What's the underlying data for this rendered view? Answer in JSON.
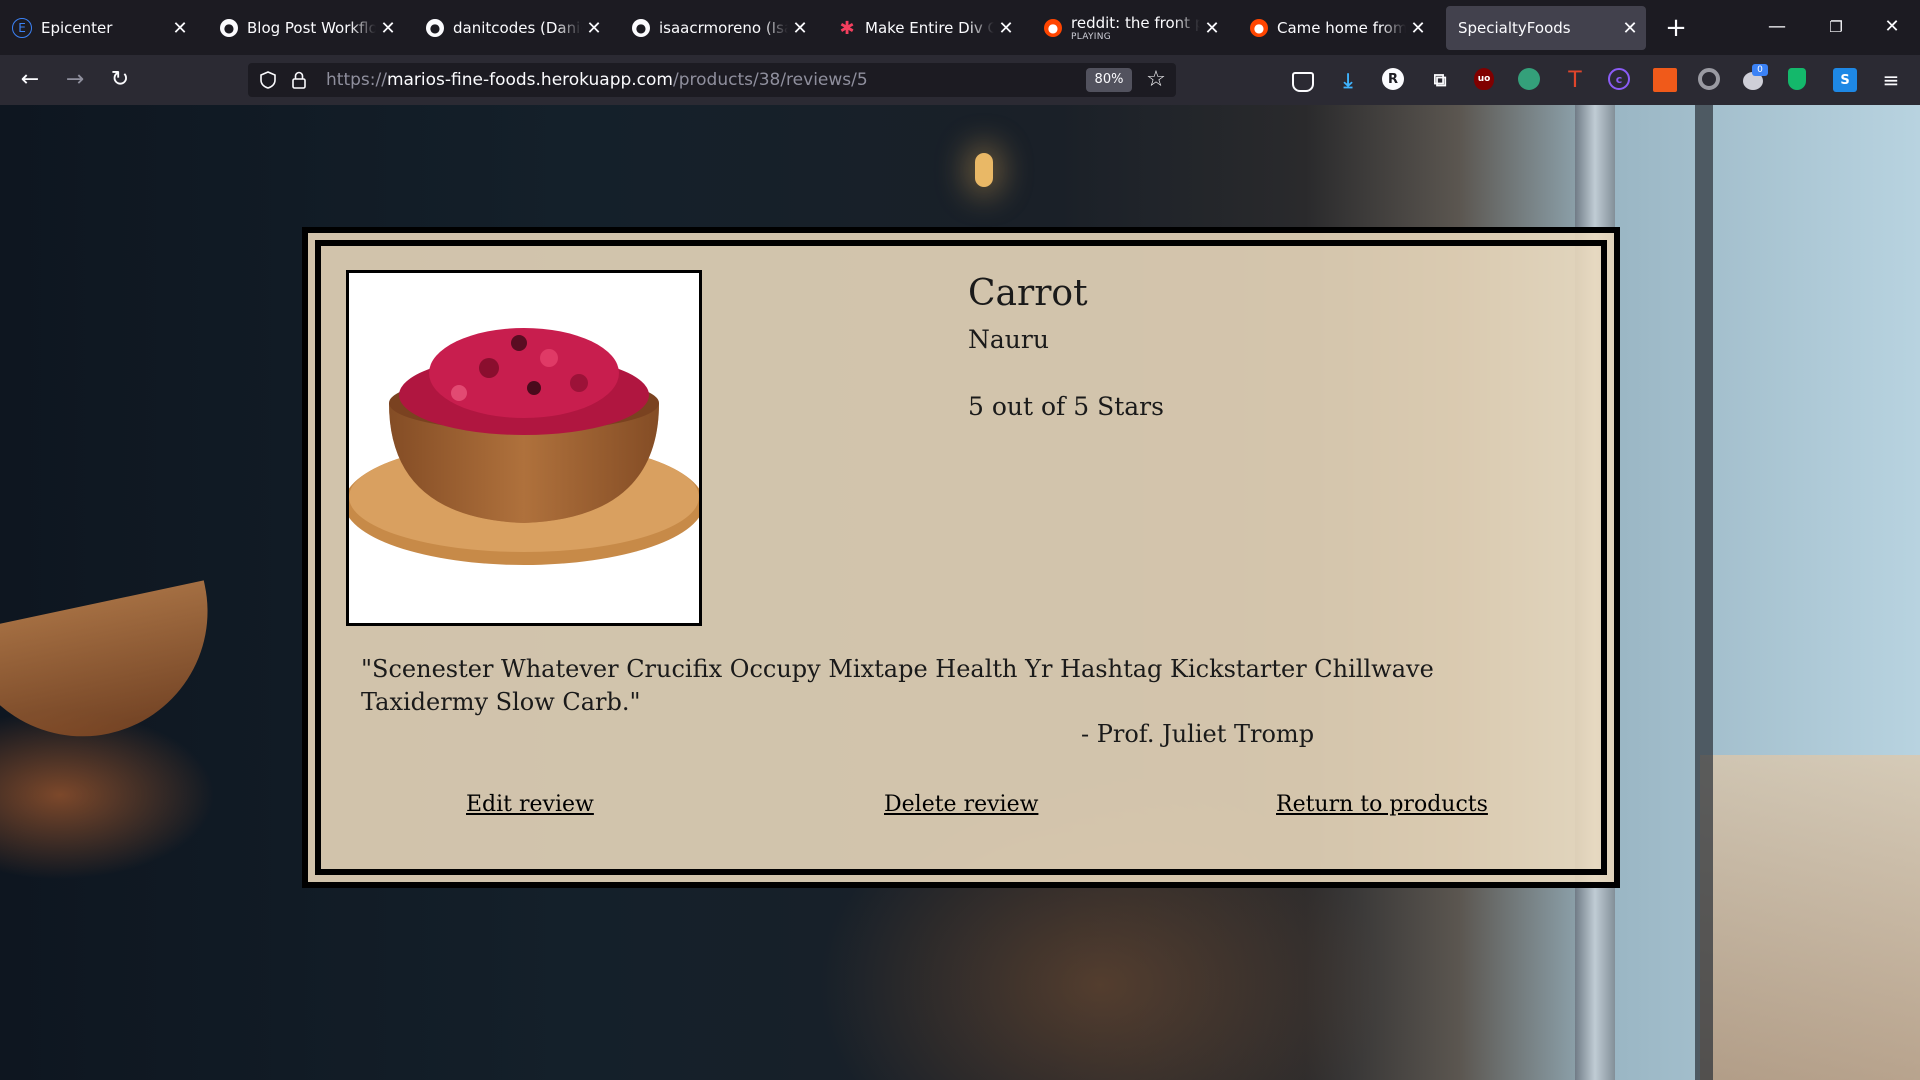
{
  "browser": {
    "tabs": [
      {
        "title": "Epicenter",
        "icon": "epicenter-icon"
      },
      {
        "title": "Blog Post Workflow",
        "icon": "github-icon"
      },
      {
        "title": "danitcodes (Danielle",
        "icon": "github-icon"
      },
      {
        "title": "isaacrmoreno (Isaac",
        "icon": "github-icon"
      },
      {
        "title": "Make Entire Div Click",
        "icon": "asterisk-icon"
      },
      {
        "title": "reddit: the front page",
        "subtitle": "PLAYING",
        "icon": "reddit-icon"
      },
      {
        "title": "Came home from ni",
        "icon": "reddit-icon"
      },
      {
        "title": "SpecialtyFoods",
        "icon": "none",
        "active": true
      }
    ],
    "url": {
      "scheme": "https://",
      "host": "marios-fine-foods.herokuapp.com",
      "path": "/products/38/reviews/5"
    },
    "zoom": "80%",
    "extensions": [
      "pocket-icon",
      "download-icon",
      "r-extension-icon",
      "extensions-icon",
      "ublock-icon",
      "green-extension-icon",
      "t-extension-icon",
      "c-extension-icon",
      "orange-extension-icon",
      "grey-extension-icon",
      "reddit-enhancement-icon",
      "shield-extension-icon",
      "s-extension-icon"
    ],
    "extension_badge": "0"
  },
  "review_page": {
    "product_name": "Carrot",
    "origin": "Nauru",
    "rating_text": "5 out of 5 Stars",
    "review_text": "\"Scenester Whatever Crucifix Occupy Mixtape Health Yr Hashtag Kickstarter Chillwave Taxidermy Slow Carb.\"",
    "author": "- Prof. Juliet Tromp",
    "links": {
      "edit": "Edit review",
      "delete": "Delete review",
      "return": "Return to products"
    }
  },
  "colors": {
    "card_bg": "#ecdbbe",
    "border": "#000000",
    "chrome_dark": "#1c1b22",
    "chrome_toolbar": "#2b2a33"
  }
}
